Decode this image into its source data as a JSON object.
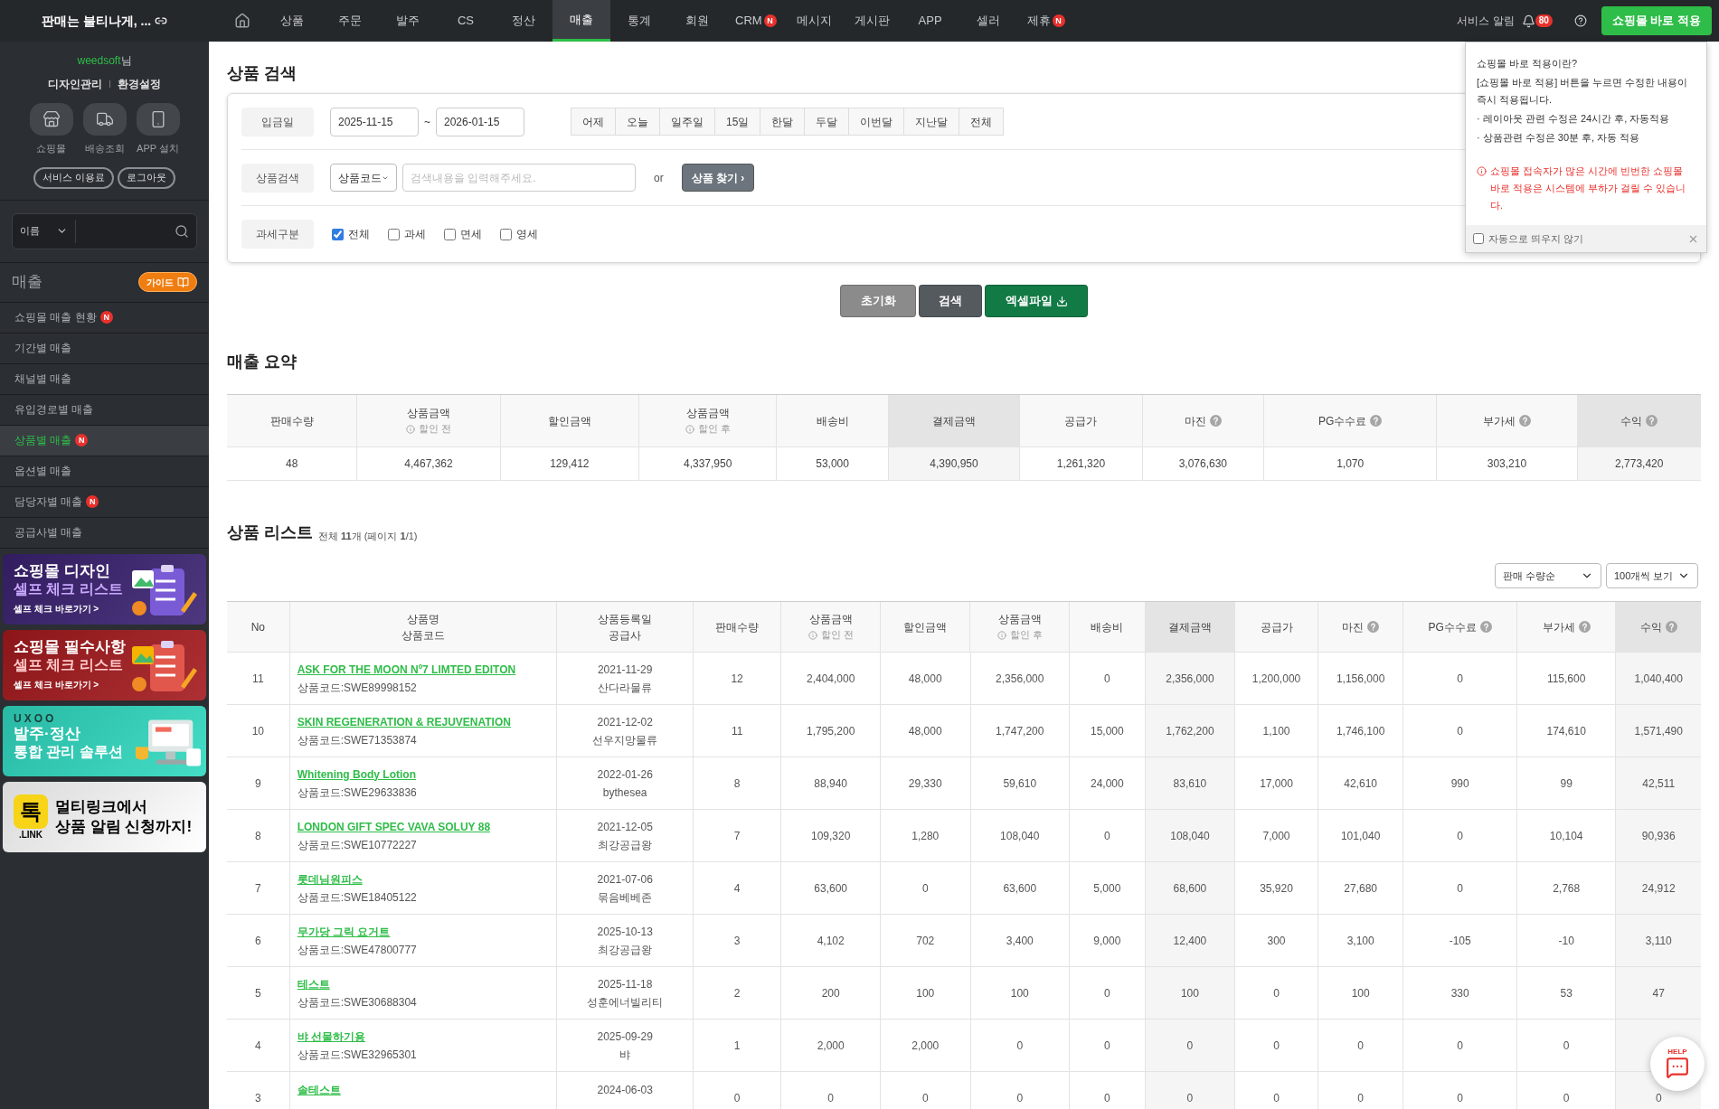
{
  "header": {
    "logo_text": "판매는 불티나게, ...",
    "nav": [
      {
        "label": "상품",
        "selected": false
      },
      {
        "label": "주문",
        "selected": false
      },
      {
        "label": "발주",
        "selected": false
      },
      {
        "label": "CS",
        "selected": false
      },
      {
        "label": "정산",
        "selected": false
      },
      {
        "label": "매출",
        "selected": true
      },
      {
        "label": "통계",
        "selected": false
      },
      {
        "label": "회원",
        "selected": false
      },
      {
        "label": "CRM",
        "selected": false,
        "badge": "N"
      },
      {
        "label": "메시지",
        "selected": false
      },
      {
        "label": "게시판",
        "selected": false
      },
      {
        "label": "APP",
        "selected": false
      },
      {
        "label": "셀러",
        "selected": false
      },
      {
        "label": "제휴",
        "selected": false,
        "badge": "N"
      }
    ],
    "service_alert": "서비스 알림",
    "alert_count": "80",
    "apply_button": "쇼핑몰 바로 적용"
  },
  "popup": {
    "title": "쇼핑몰 바로 적용이란?",
    "lines": [
      "[쇼핑몰 바로 적용] 버튼을 누르면 수정한 내용이 즉시 적용됩니다.",
      "· 레이아웃 관련 수정은 24시간 후, 자동적용",
      "· 상품관련 수정은 30분 후, 자동 적용"
    ],
    "warning": "쇼핑몰 접속자가 많은 시간에 빈번한 쇼핑몰 바로 적용은 시스템에 부하가 걸릴 수 있습니다.",
    "no_auto_label": "자동으로 띄우지 않기",
    "no_auto_checked": false
  },
  "sidebar": {
    "user_name": "weedsoft",
    "user_suffix": "님",
    "links": [
      "디자인관리",
      "환경설정"
    ],
    "quick": [
      {
        "label": "쇼핑몰",
        "kind": "store"
      },
      {
        "label": "배송조회",
        "kind": "truck"
      },
      {
        "label": "APP 설치",
        "kind": "phone"
      }
    ],
    "pills": [
      "서비스 이용료",
      "로그아웃"
    ],
    "search_select": "이름",
    "section_title": "매출",
    "guide_button": "가이드",
    "menu": [
      {
        "label": "쇼핑몰 매출 현황",
        "selected": false,
        "badge": "N"
      },
      {
        "label": "기간별 매출",
        "selected": false
      },
      {
        "label": "채널별 매출",
        "selected": false
      },
      {
        "label": "유입경로별 매출",
        "selected": false
      },
      {
        "label": "상품별 매출",
        "selected": true,
        "badge": "N"
      },
      {
        "label": "옵션별 매출",
        "selected": false
      },
      {
        "label": "담당자별 매출",
        "selected": false,
        "badge": "N"
      },
      {
        "label": "공급사별 매출",
        "selected": false
      }
    ],
    "banners": [
      {
        "kind": "design",
        "title": "쇼핑몰 디자인",
        "subtitle": "셀프 체크 리스트",
        "link": "셀프 체크 바로가기 >",
        "color": "#3a2170"
      },
      {
        "kind": "required",
        "title": "쇼핑몰 필수사항",
        "subtitle": "셀프 체크 리스트",
        "link": "셀프 체크 바로가기 >",
        "color": "#a3191d"
      },
      {
        "kind": "uxoo",
        "logo": "UXOO",
        "title": "발주·정산",
        "subtitle": "통합 관리 솔루션",
        "color": "#2fd9c0"
      },
      {
        "kind": "link",
        "logo": "톡",
        "logo_sub": ".LINK",
        "title": "멀티링크에서",
        "subtitle": "상품 알림 신청까지!",
        "color": "#ffffff"
      }
    ]
  },
  "search": {
    "title": "상품 검색",
    "date_label": "입금일",
    "start": "2025-11-15",
    "sep": "~",
    "end": "2026-01-15",
    "presets": [
      "어제",
      "오늘",
      "일주일",
      "15일",
      "한달",
      "두달",
      "이번달",
      "지난달",
      "전체"
    ],
    "product_label": "상품검색",
    "product_select": "상품코드",
    "placeholder": "검색내용을 입력해주세요.",
    "or": "or",
    "find_button": "상품 찾기 ›",
    "tax_label": "과세구분",
    "tax_options": [
      {
        "label": "전체",
        "checked": true
      },
      {
        "label": "과세",
        "checked": false
      },
      {
        "label": "면세",
        "checked": false
      },
      {
        "label": "영세",
        "checked": false
      }
    ]
  },
  "actions": [
    {
      "kind": "reset",
      "label": "초기화"
    },
    {
      "kind": "search",
      "label": "검색"
    },
    {
      "kind": "excel",
      "label": "엑셀파일"
    }
  ],
  "summary": {
    "title": "매출 요약",
    "columns": [
      {
        "label": "판매수량"
      },
      {
        "label": "상품금액",
        "sub": "할인 전"
      },
      {
        "label": "할인금액"
      },
      {
        "label": "상품금액",
        "sub": "할인 후"
      },
      {
        "label": "배송비"
      },
      {
        "label": "결제금액",
        "shaded": true
      },
      {
        "label": "공급가"
      },
      {
        "label": "마진",
        "help": true
      },
      {
        "label": "PG수수료",
        "help": true
      },
      {
        "label": "부가세",
        "help": true
      },
      {
        "label": "수익",
        "help": true,
        "shaded": true
      }
    ],
    "values": [
      "48",
      "4,467,362",
      "129,412",
      "4,337,950",
      "53,000",
      "4,390,950",
      "1,261,320",
      "3,076,630",
      "1,070",
      "303,210",
      "2,773,420"
    ]
  },
  "list": {
    "title": "상품 리스트",
    "info": "전체 **11**개 (페이지 **1**/1)",
    "sort": "판매 수량순",
    "per_page": "100개씩 보기",
    "columns": [
      {
        "label": "No"
      },
      {
        "label": "상품명",
        "label2": "상품코드"
      },
      {
        "label": "상품등록일",
        "label2": "공급사"
      },
      {
        "label": "판매수량"
      },
      {
        "label": "상품금액",
        "sub": "할인 전"
      },
      {
        "label": "할인금액"
      },
      {
        "label": "상품금액",
        "sub": "할인 후"
      },
      {
        "label": "배송비"
      },
      {
        "label": "결제금액",
        "shaded": true
      },
      {
        "label": "공급가"
      },
      {
        "label": "마진",
        "help": true
      },
      {
        "label": "PG수수료",
        "help": true
      },
      {
        "label": "부가세",
        "help": true
      },
      {
        "label": "수익",
        "help": true,
        "shaded": true
      }
    ],
    "rows": [
      {
        "no": "11",
        "name": "ASK FOR THE MOON Nº7 LIMTED EDITON",
        "code": "상품코드:SWE89998152",
        "date": "2021-11-29",
        "supplier": "산다라물류",
        "values": [
          "12",
          "2,404,000",
          "48,000",
          "2,356,000",
          "0",
          "2,356,000",
          "1,200,000",
          "1,156,000",
          "0",
          "115,600",
          "1,040,400"
        ]
      },
      {
        "no": "10",
        "name": "SKIN REGENERATION & REJUVENATION",
        "code": "상품코드:SWE71353874",
        "date": "2021-12-02",
        "supplier": "선우지망물류",
        "values": [
          "11",
          "1,795,200",
          "48,000",
          "1,747,200",
          "15,000",
          "1,762,200",
          "1,100",
          "1,746,100",
          "0",
          "174,610",
          "1,571,490"
        ]
      },
      {
        "no": "9",
        "name": "Whitening Body Lotion",
        "code": "상품코드:SWE29633836",
        "date": "2022-01-26",
        "supplier": "bythesea",
        "values": [
          "8",
          "88,940",
          "29,330",
          "59,610",
          "24,000",
          "83,610",
          "17,000",
          "42,610",
          "990",
          "99",
          "42,511"
        ]
      },
      {
        "no": "8",
        "name": "LONDON GIFT SPEC VAVA SOLUY 88",
        "code": "상품코드:SWE10772227",
        "date": "2021-12-05",
        "supplier": "최강공급왕",
        "values": [
          "7",
          "109,320",
          "1,280",
          "108,040",
          "0",
          "108,040",
          "7,000",
          "101,040",
          "0",
          "10,104",
          "90,936"
        ]
      },
      {
        "no": "7",
        "name": "롯데님원피스",
        "code": "상품코드:SWE18405122",
        "date": "2021-07-06",
        "supplier": "묶음베베존",
        "values": [
          "4",
          "63,600",
          "0",
          "63,600",
          "5,000",
          "68,600",
          "35,920",
          "27,680",
          "0",
          "2,768",
          "24,912"
        ]
      },
      {
        "no": "6",
        "name": "무가당 그릭 요거트",
        "code": "상품코드:SWE47800777",
        "date": "2025-10-13",
        "supplier": "최강공급왕",
        "values": [
          "3",
          "4,102",
          "702",
          "3,400",
          "9,000",
          "12,400",
          "300",
          "3,100",
          "-105",
          "-10",
          "3,110"
        ]
      },
      {
        "no": "5",
        "name": "테스트",
        "code": "상품코드:SWE30688304",
        "date": "2025-11-18",
        "supplier": "성훈에너빌리티",
        "values": [
          "2",
          "200",
          "100",
          "100",
          "0",
          "100",
          "0",
          "100",
          "330",
          "53",
          "47"
        ]
      },
      {
        "no": "4",
        "name": "뱌 선물하기용",
        "code": "상품코드:SWE32965301",
        "date": "2025-09-29",
        "supplier": "뱌",
        "values": [
          "1",
          "2,000",
          "2,000",
          "0",
          "0",
          "0",
          "0",
          "0",
          "0",
          "0"
        ]
      },
      {
        "no": "3",
        "name": "솔테스트",
        "date": "2024-06-03",
        "values": [
          "0",
          "0",
          "0",
          "0",
          "0",
          "0",
          "0",
          "0",
          "0",
          "0",
          "0"
        ]
      }
    ]
  },
  "help_button": "HELP"
}
